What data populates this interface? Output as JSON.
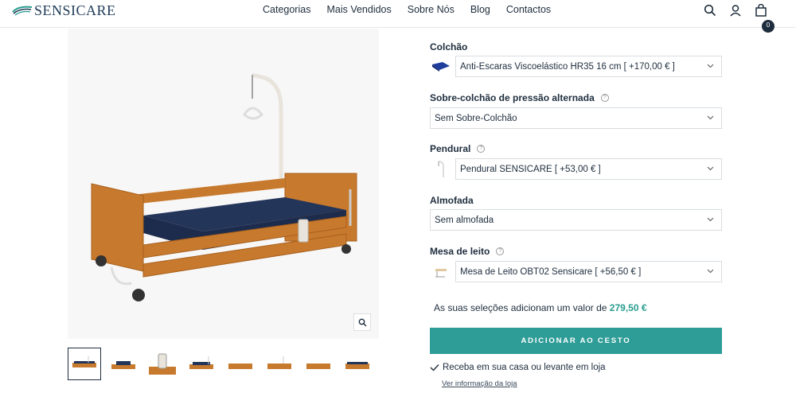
{
  "header": {
    "logo_text": "SENSICARE",
    "nav": [
      "Categorias",
      "Mais Vendidos",
      "Sobre Nós",
      "Blog",
      "Contactos"
    ],
    "cart_count": "0"
  },
  "options": [
    {
      "label": "Colchão",
      "value": "Anti-Escaras Viscoelástico HR35 16 cm [ +170,00 € ]",
      "swatch": "mattress",
      "help": false
    },
    {
      "label": "Sobre-colchão de pressão alternada",
      "value": "Sem Sobre-Colchão",
      "swatch": null,
      "help": true
    },
    {
      "label": "Pendural",
      "value": "Pendural SENSICARE [ +53,00 € ]",
      "swatch": "pendant",
      "help": true
    },
    {
      "label": "Almofada",
      "value": "Sem almofada",
      "swatch": null,
      "help": false
    },
    {
      "label": "Mesa de leito",
      "value": "Mesa de Leito OBT02 Sensicare [ +56,50 € ]",
      "swatch": "table",
      "help": true
    }
  ],
  "summary": {
    "text": "As suas seleções adicionam um valor de",
    "price": "279,50 €"
  },
  "add_button": "ADICIONAR AO CESTO",
  "delivery": "Receba em sua casa ou levante em loja",
  "store_link": "Ver informação da loja",
  "colors": {
    "accent": "#2f9d97",
    "text": "#1e2d3d"
  }
}
